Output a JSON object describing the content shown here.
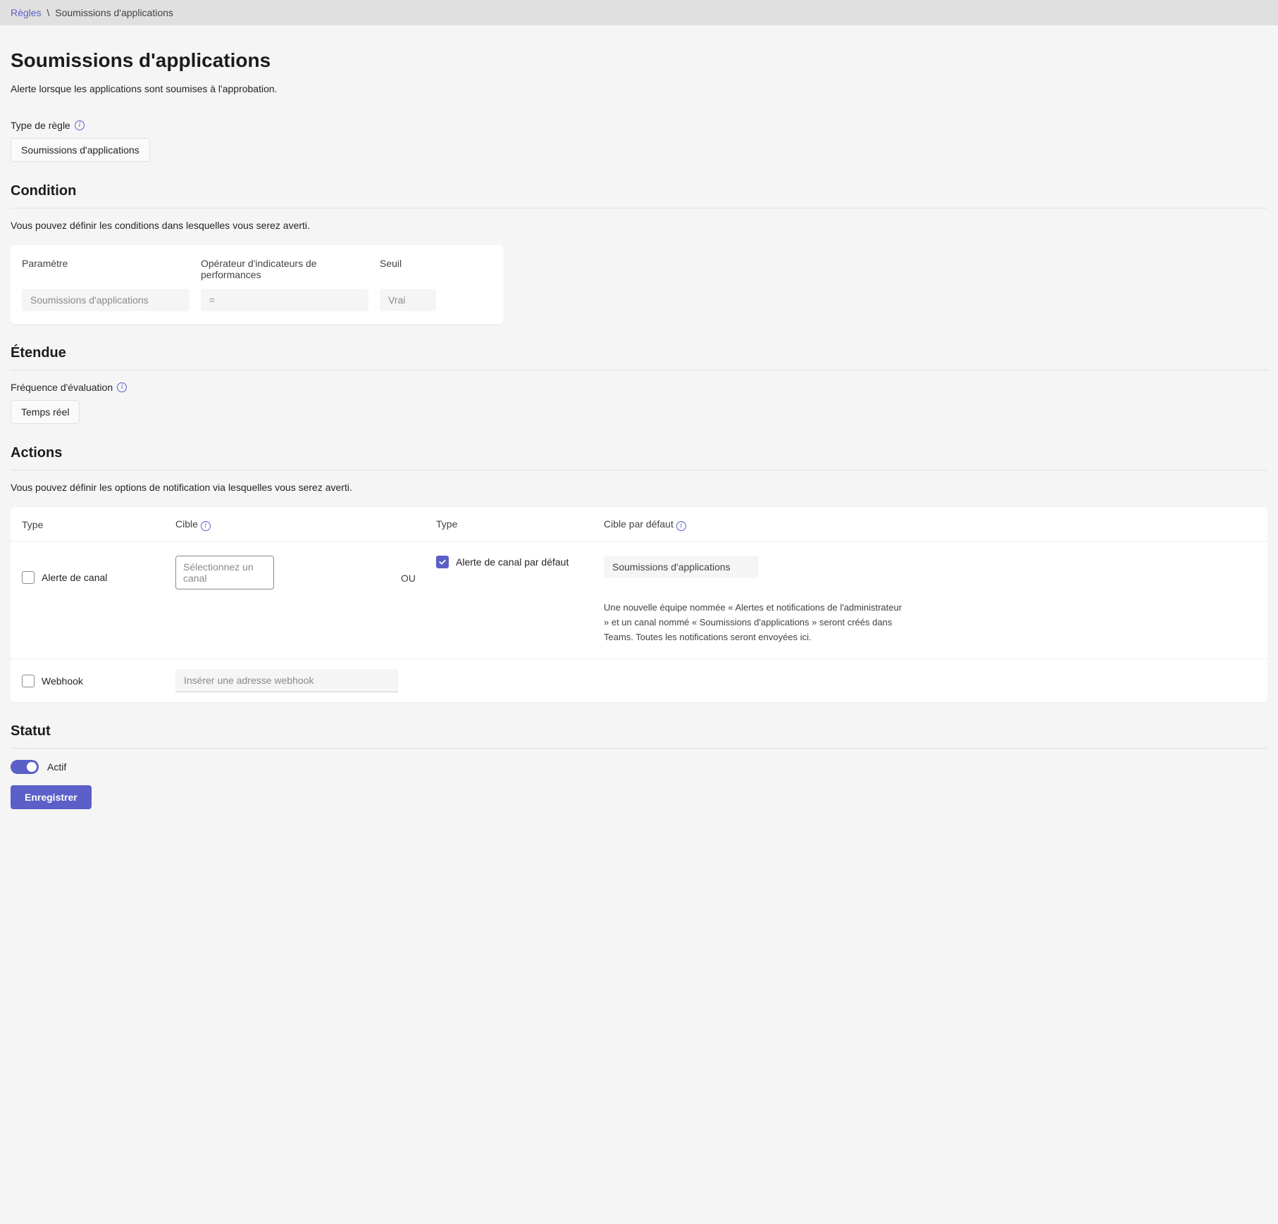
{
  "breadcrumb": {
    "root": "Règles",
    "sep": "\\",
    "current": "Soumissions d'applications"
  },
  "page": {
    "title": "Soumissions d'applications",
    "description": "Alerte lorsque les applications sont soumises à l'approbation."
  },
  "rule_type": {
    "label": "Type de règle",
    "value": "Soumissions d'applications"
  },
  "condition": {
    "heading": "Condition",
    "description": "Vous pouvez définir les conditions dans lesquelles vous serez averti.",
    "headers": {
      "param": "Paramètre",
      "operator": "Opérateur d'indicateurs de performances",
      "threshold": "Seuil"
    },
    "row": {
      "param": "Soumissions d'applications",
      "operator": "=",
      "threshold": "Vrai"
    }
  },
  "scope": {
    "heading": "Étendue",
    "freq_label": "Fréquence d'évaluation",
    "freq_value": "Temps réel"
  },
  "actions": {
    "heading": "Actions",
    "description": "Vous pouvez définir les options de notification via lesquelles vous serez averti.",
    "headers": {
      "type1": "Type",
      "target1": "Cible",
      "type2": "Type",
      "target2": "Cible par défaut"
    },
    "or_label": "OU",
    "channel_alert": {
      "label": "Alerte de canal",
      "placeholder": "Sélectionnez un canal"
    },
    "default_channel": {
      "label": "Alerte de canal par défaut",
      "target": "Soumissions d'applications",
      "description": "Une nouvelle équipe nommée « Alertes et notifications de l'administrateur » et un canal nommé « Soumissions d'applications » seront créés dans Teams. Toutes les notifications seront envoyées ici."
    },
    "webhook": {
      "label": "Webhook",
      "placeholder": "Insérer une adresse webhook"
    }
  },
  "status": {
    "heading": "Statut",
    "toggle_label": "Actif",
    "save_button": "Enregistrer"
  }
}
